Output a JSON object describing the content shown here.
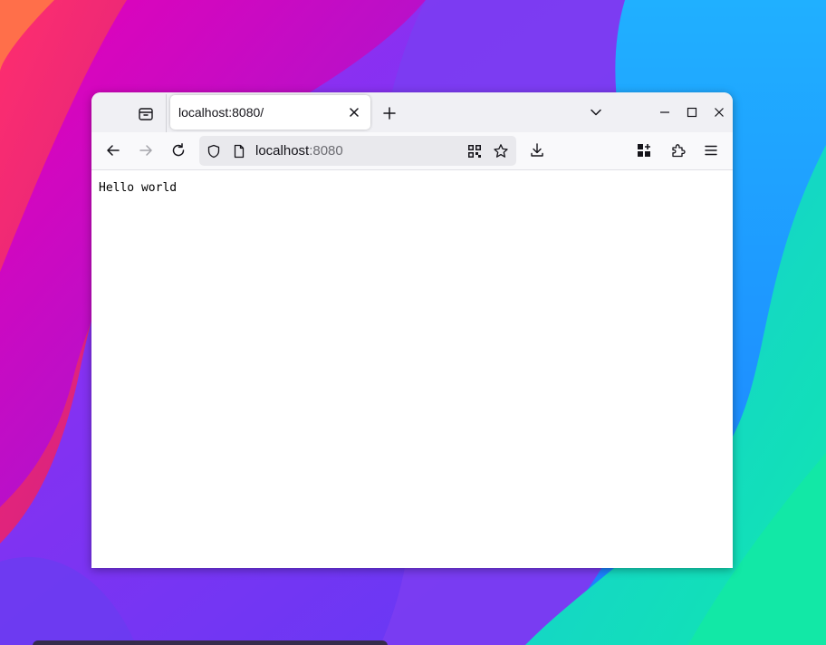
{
  "browser": {
    "tab": {
      "title": "localhost:8080/"
    },
    "urlbar": {
      "host": "localhost",
      "port": ":8080"
    }
  },
  "page": {
    "body_text": "Hello world"
  },
  "icons": {
    "tab_manager": "tab-manager-icon",
    "tab_close": "close-icon",
    "new_tab": "plus-icon",
    "tab_list": "chevron-down-icon",
    "window_minimize": "minimize-icon",
    "window_maximize": "maximize-icon",
    "window_close": "close-icon",
    "back": "arrow-left-icon",
    "forward": "arrow-right-icon",
    "reload": "reload-icon",
    "shield": "shield-icon",
    "page": "page-icon",
    "qr_code": "qr-code-icon",
    "bookmark": "star-icon",
    "downloads": "download-icon",
    "extension_grid": "grid-plus-icon",
    "extensions": "puzzle-icon",
    "app_menu": "hamburger-menu-icon"
  },
  "colors": {
    "tab_strip": "#f0f0f4",
    "nav_bar": "#f9f9fb",
    "url_field": "#e9e9ed",
    "text": "#15141a",
    "disabled": "#a4a4aa"
  }
}
